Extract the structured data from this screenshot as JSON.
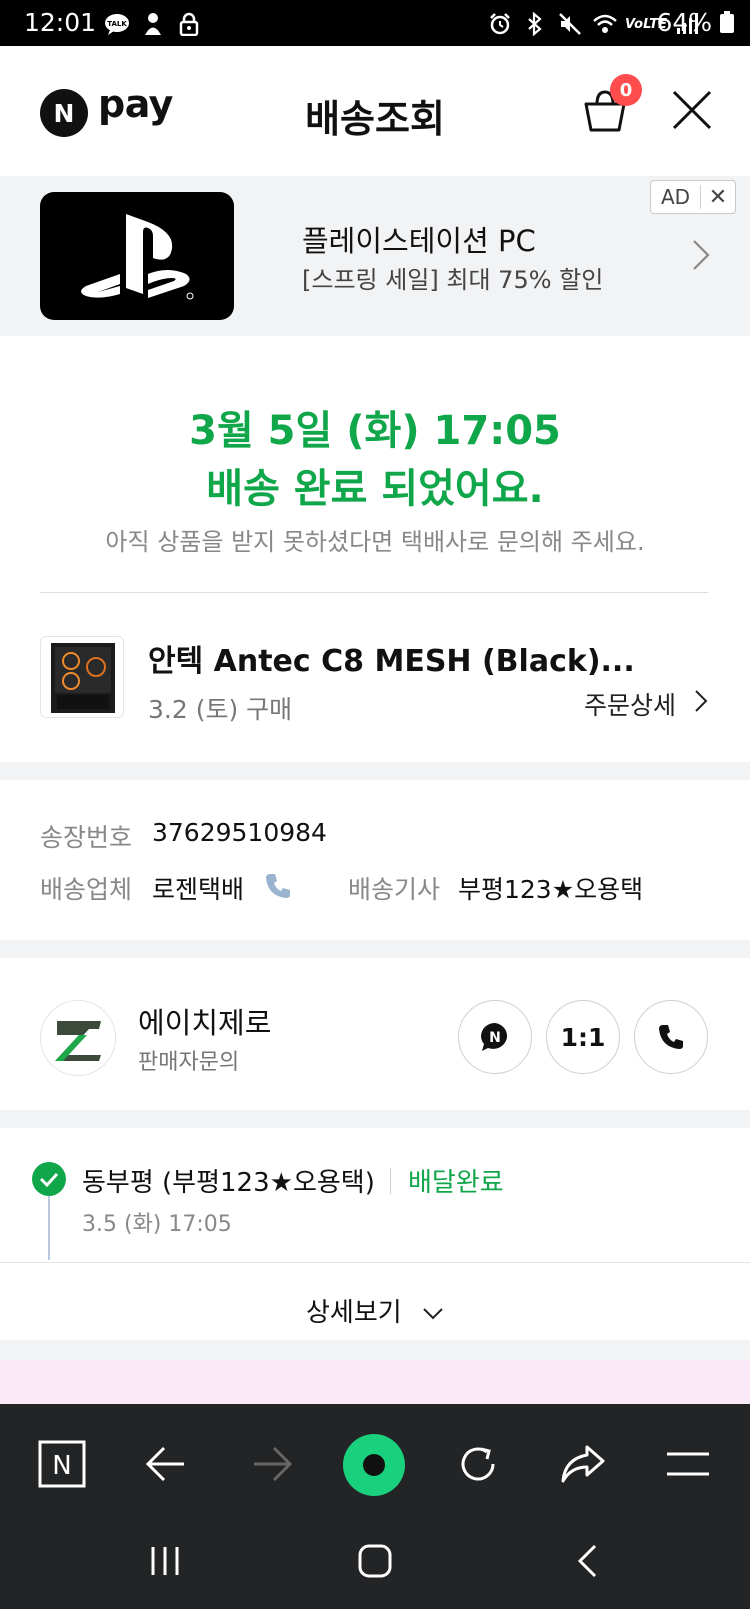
{
  "status_bar": {
    "time": "12:01",
    "battery": "64%",
    "network_label": "VoLTE",
    "left_icons": [
      "kakaotalk-icon",
      "app-notification-icon",
      "lock-icon"
    ],
    "right_icons": [
      "alarm-icon",
      "bluetooth-icon",
      "mute-icon",
      "wifi-icon",
      "volte-icon",
      "signal-icon",
      "battery-icon"
    ]
  },
  "header": {
    "logo_n": "N",
    "logo_text": "pay",
    "title": "배송조회",
    "cart_count": "0"
  },
  "ad": {
    "title": "플레이스테이션 PC",
    "subtitle": "[스프링 세일] 최대 75% 할인",
    "tag": "AD",
    "tag_close": "✕"
  },
  "delivery": {
    "line1": "3월 5일 (화) 17:05",
    "line2": "배송 완료 되었어요.",
    "note": "아직 상품을 받지 못하셨다면 택배사로 문의해 주세요.",
    "accent_color": "#10a64a"
  },
  "product": {
    "name": "안텍 Antec C8 MESH (Black)...",
    "purchase_date": "3.2 (토) 구매",
    "order_detail_label": "주문상세"
  },
  "shipment": {
    "invoice_label": "송장번호",
    "invoice_number": "37629510984",
    "carrier_label": "배송업체",
    "carrier": "로젠택배",
    "driver_label": "배송기사",
    "driver": "부평123★오용택"
  },
  "seller": {
    "name": "에이치제로",
    "sub": "판매자문의",
    "talk_label": "N",
    "chat_label": "1:1"
  },
  "tracking": {
    "location": "동부평 (부평123★오용택)",
    "status": "배달완료",
    "time": "3.5 (화) 17:05",
    "more_label": "상세보기"
  },
  "toolbar": {
    "home_label": "N"
  }
}
